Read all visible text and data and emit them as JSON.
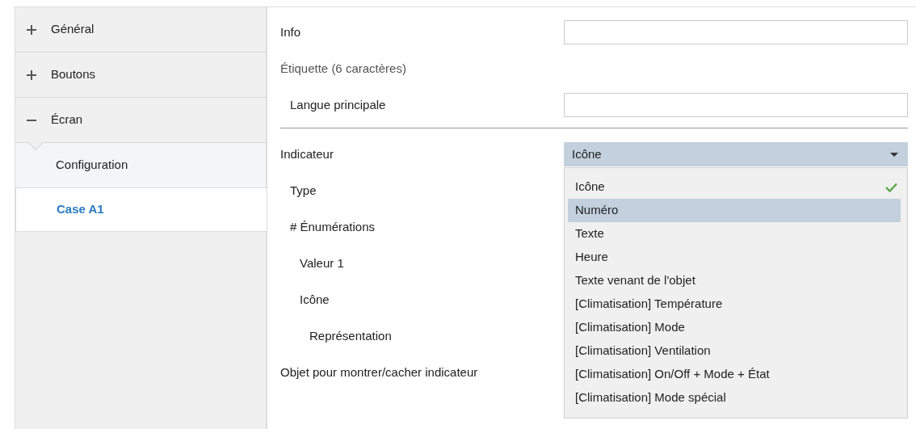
{
  "sidebar": {
    "items": [
      {
        "label": "Général",
        "expanded": false
      },
      {
        "label": "Boutons",
        "expanded": false
      },
      {
        "label": "Écran",
        "expanded": true,
        "children": [
          {
            "label": "Configuration",
            "selected": false
          },
          {
            "label": "Case A1",
            "selected": true
          }
        ]
      }
    ]
  },
  "parameters": [
    {
      "kind": "field",
      "label": "Info"
    },
    {
      "kind": "heading",
      "label": "Étiquette (6 caractères)",
      "children": [
        {
          "kind": "field",
          "label": "Langue principale"
        }
      ]
    },
    {
      "kind": "divider"
    },
    {
      "kind": "select",
      "label": "Indicateur",
      "value": "Icône",
      "open": true,
      "children": [
        {
          "kind": "label",
          "label": "Type"
        },
        {
          "kind": "label",
          "label": "# Énumérations",
          "children": [
            {
              "kind": "label",
              "label": "Valeur 1"
            },
            {
              "kind": "label",
              "label": "Icône",
              "children": [
                {
                  "kind": "label",
                  "label": "Représentation"
                }
              ]
            }
          ]
        }
      ]
    },
    {
      "kind": "label",
      "label": "Objet pour montrer/cacher indicateur"
    }
  ],
  "dropdown": {
    "options": [
      {
        "label": "Icône",
        "selected": true,
        "highlighted": false
      },
      {
        "label": "Numéro",
        "selected": false,
        "highlighted": true
      },
      {
        "label": "Texte",
        "selected": false,
        "highlighted": false
      },
      {
        "label": "Heure",
        "selected": false,
        "highlighted": false
      },
      {
        "label": "Texte venant de l'objet",
        "selected": false,
        "highlighted": false
      },
      {
        "label": "[Climatisation] Température",
        "selected": false,
        "highlighted": false
      },
      {
        "label": "[Climatisation] Mode",
        "selected": false,
        "highlighted": false
      },
      {
        "label": "[Climatisation] Ventilation",
        "selected": false,
        "highlighted": false
      },
      {
        "label": "[Climatisation] On/Off + Mode + État",
        "selected": false,
        "highlighted": false
      },
      {
        "label": "[Climatisation] Mode spécial",
        "selected": false,
        "highlighted": false
      }
    ]
  }
}
